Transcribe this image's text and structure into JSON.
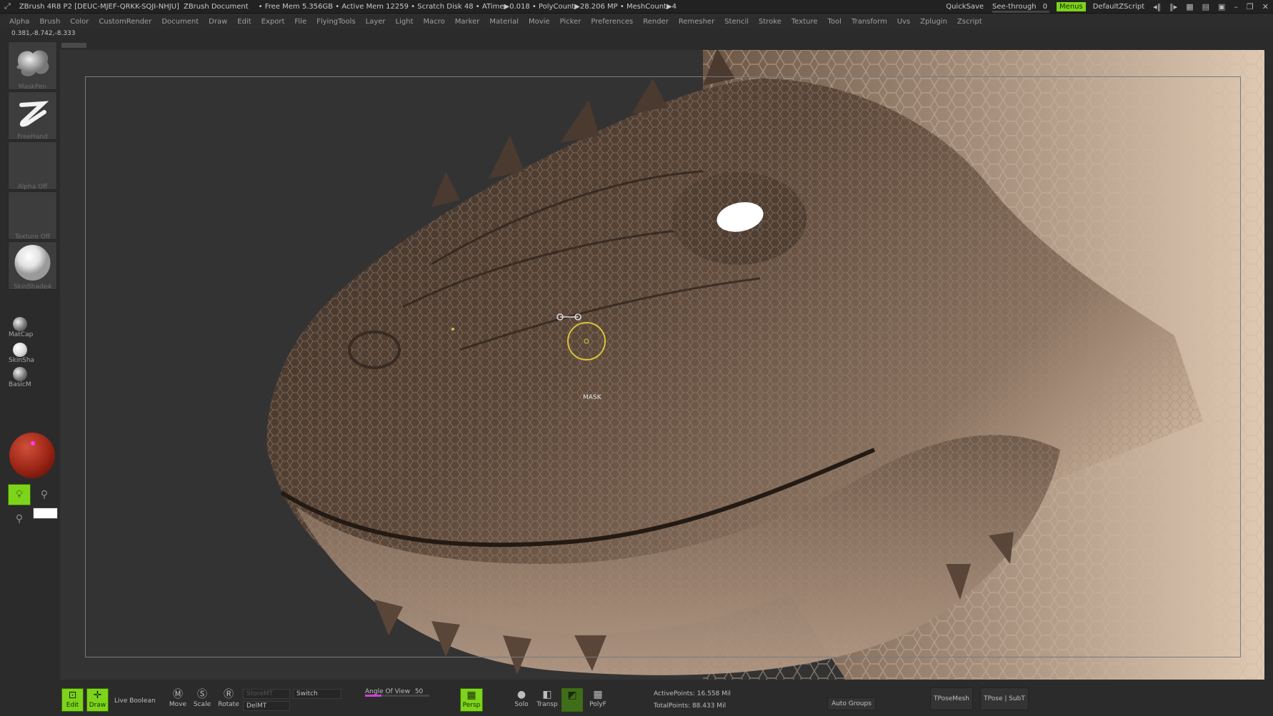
{
  "titlebar": {
    "app": "ZBrush 4R8 P2 [DEUC-MJEF-QRKK-SQJI-NHJU]",
    "document": "ZBrush Document",
    "stats": "• Free Mem 5.356GB • Active Mem 12259 • Scratch Disk 48 • ATime▶0.018 • PolyCount▶28.206 MP • MeshCount▶4",
    "quicksave": "QuickSave",
    "seethrough_label": "See-through",
    "seethrough_value": "0",
    "seethrough_level": 0.1,
    "menus": "Menus",
    "script": "DefaultZScript"
  },
  "menubar": [
    "Alpha",
    "Brush",
    "Color",
    "CustomRender",
    "Document",
    "Draw",
    "Edit",
    "Export",
    "File",
    "FlyingTools",
    "Layer",
    "Light",
    "Macro",
    "Marker",
    "Material",
    "Movie",
    "Picker",
    "Preferences",
    "Render",
    "Remesher",
    "Stencil",
    "Stroke",
    "Texture",
    "Tool",
    "Transform",
    "Uvs",
    "Zplugin",
    "Zscript"
  ],
  "coords": "0.381,-8.742,-8.333",
  "shelf": {
    "brush": "MaskPen",
    "stroke": "FreeHand",
    "alpha": "Alpha Off",
    "texture": "Texture Off",
    "material": "SkinShade4",
    "mat1": "MatCap",
    "mat2": "SkinSha",
    "mat3": "BasicM"
  },
  "cursor_label": "MASK",
  "bottombar": {
    "edit": "Edit",
    "draw": "Draw",
    "live_boolean": "Live Boolean",
    "move": "Move",
    "scale": "Scale",
    "rotate": "Rotate",
    "storemt": "StoreMT",
    "delmt": "DelMT",
    "switch": "Switch",
    "aov_label": "Angle Of View",
    "aov_value": "50",
    "aov_level": 0.25,
    "persp": "Persp",
    "solo": "Solo",
    "transp": "Transp",
    "polyf": "PolyF",
    "active_points": "ActivePoints: 16.558 Mil",
    "total_points": "TotalPoints: 88.433 Mil",
    "auto_groups": "Auto Groups",
    "tpose_mesh": "TPoseMesh",
    "tpose_subt": "TPose | SubT"
  },
  "colors": {
    "accent_green": "#7cd41b",
    "accent_magenta": "#d63bd6",
    "cursor_yellow": "#d8c43a"
  },
  "icons": {
    "edit": "edit-icon",
    "draw": "draw-icon",
    "move": "move-icon",
    "scale": "scale-icon",
    "rotate": "rotate-icon",
    "light": "lightbulb-icon"
  }
}
